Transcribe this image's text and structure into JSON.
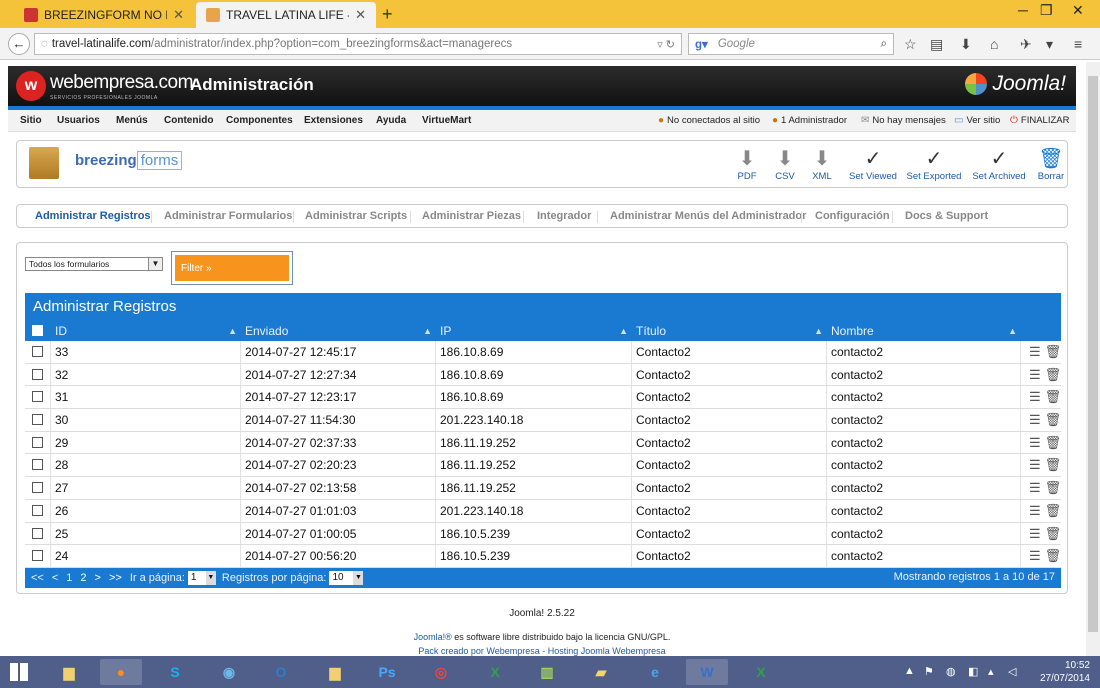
{
  "browser": {
    "tabs": [
      {
        "title": "BREEZINGFORM NO ENVIA...",
        "active": false
      },
      {
        "title": "TRAVEL LATINA LIFE - TO...",
        "active": true
      }
    ],
    "url_host": "travel-latinalife.com",
    "url_path": "/administrator/index.php?option=com_breezingforms&act=managerecs",
    "search_placeholder": "Google"
  },
  "header": {
    "brand": "webempresa.com",
    "brand_sub": "SERVICIOS PROFESIONALES JOOMLA",
    "title": "Administración",
    "joomla": "Joomla!"
  },
  "menu": {
    "items": [
      "Sitio",
      "Usuarios",
      "Menús",
      "Contenido",
      "Componentes",
      "Extensiones",
      "Ayuda",
      "VirtueMart"
    ],
    "status": [
      "No conectados al sitio",
      "1 Administrador",
      "No hay mensajes",
      "Ver sitio",
      "FINALIZAR"
    ]
  },
  "component": {
    "logo_a": "breezing",
    "logo_b": "forms",
    "toolbar": [
      "PDF",
      "CSV",
      "XML",
      "Set Viewed",
      "Set Exported",
      "Set Archived",
      "Borrar"
    ]
  },
  "subtabs": [
    "Administrar Registros",
    "Administrar Formularios",
    "Administrar Scripts",
    "Administrar Piezas",
    "Integrador",
    "Administrar Menús del Administrador",
    "Configuración",
    "Docs & Support"
  ],
  "filter": {
    "form_select": "Todos los formularios",
    "button": "Filter »"
  },
  "grid": {
    "title": "Administrar Registros",
    "columns": [
      "ID",
      "Enviado",
      "IP",
      "Título",
      "Nombre"
    ],
    "rows": [
      [
        "33",
        "2014-07-27 12:45:17",
        "186.10.8.69",
        "Contacto2",
        "contacto2"
      ],
      [
        "32",
        "2014-07-27 12:27:34",
        "186.10.8.69",
        "Contacto2",
        "contacto2"
      ],
      [
        "31",
        "2014-07-27 12:23:17",
        "186.10.8.69",
        "Contacto2",
        "contacto2"
      ],
      [
        "30",
        "2014-07-27 11:54:30",
        "201.223.140.18",
        "Contacto2",
        "contacto2"
      ],
      [
        "29",
        "2014-07-27 02:37:33",
        "186.11.19.252",
        "Contacto2",
        "contacto2"
      ],
      [
        "28",
        "2014-07-27 02:20:23",
        "186.11.19.252",
        "Contacto2",
        "contacto2"
      ],
      [
        "27",
        "2014-07-27 02:13:58",
        "186.11.19.252",
        "Contacto2",
        "contacto2"
      ],
      [
        "26",
        "2014-07-27 01:01:03",
        "201.223.140.18",
        "Contacto2",
        "contacto2"
      ],
      [
        "25",
        "2014-07-27 01:00:05",
        "186.10.5.239",
        "Contacto2",
        "contacto2"
      ],
      [
        "24",
        "2014-07-27 00:56:20",
        "186.10.5.239",
        "Contacto2",
        "contacto2"
      ]
    ],
    "pager": {
      "first": "<<",
      "prev": "<",
      "page1": "1",
      "page2": "2",
      "next": ">",
      "last": ">>",
      "goto_label": "Ir a página:",
      "goto_value": "1",
      "per_page_label": "Registros por página:",
      "per_page_value": "10",
      "showing": "Mostrando registros 1 a 10 de 17"
    }
  },
  "footer": {
    "version": "Joomla! 2.5.22",
    "license_link": "Joomla!®",
    "license_text": " es software libre distribuido bajo la licencia GNU/GPL.",
    "pack": "Pack creado por Webempresa - Hosting Joomla Webempresa"
  },
  "taskbar": {
    "time": "10:52",
    "date": "27/07/2014"
  },
  "colors": {
    "accent": "#1a7ad1",
    "filter": "#f7941d",
    "tabbar": "#f5c33a"
  }
}
